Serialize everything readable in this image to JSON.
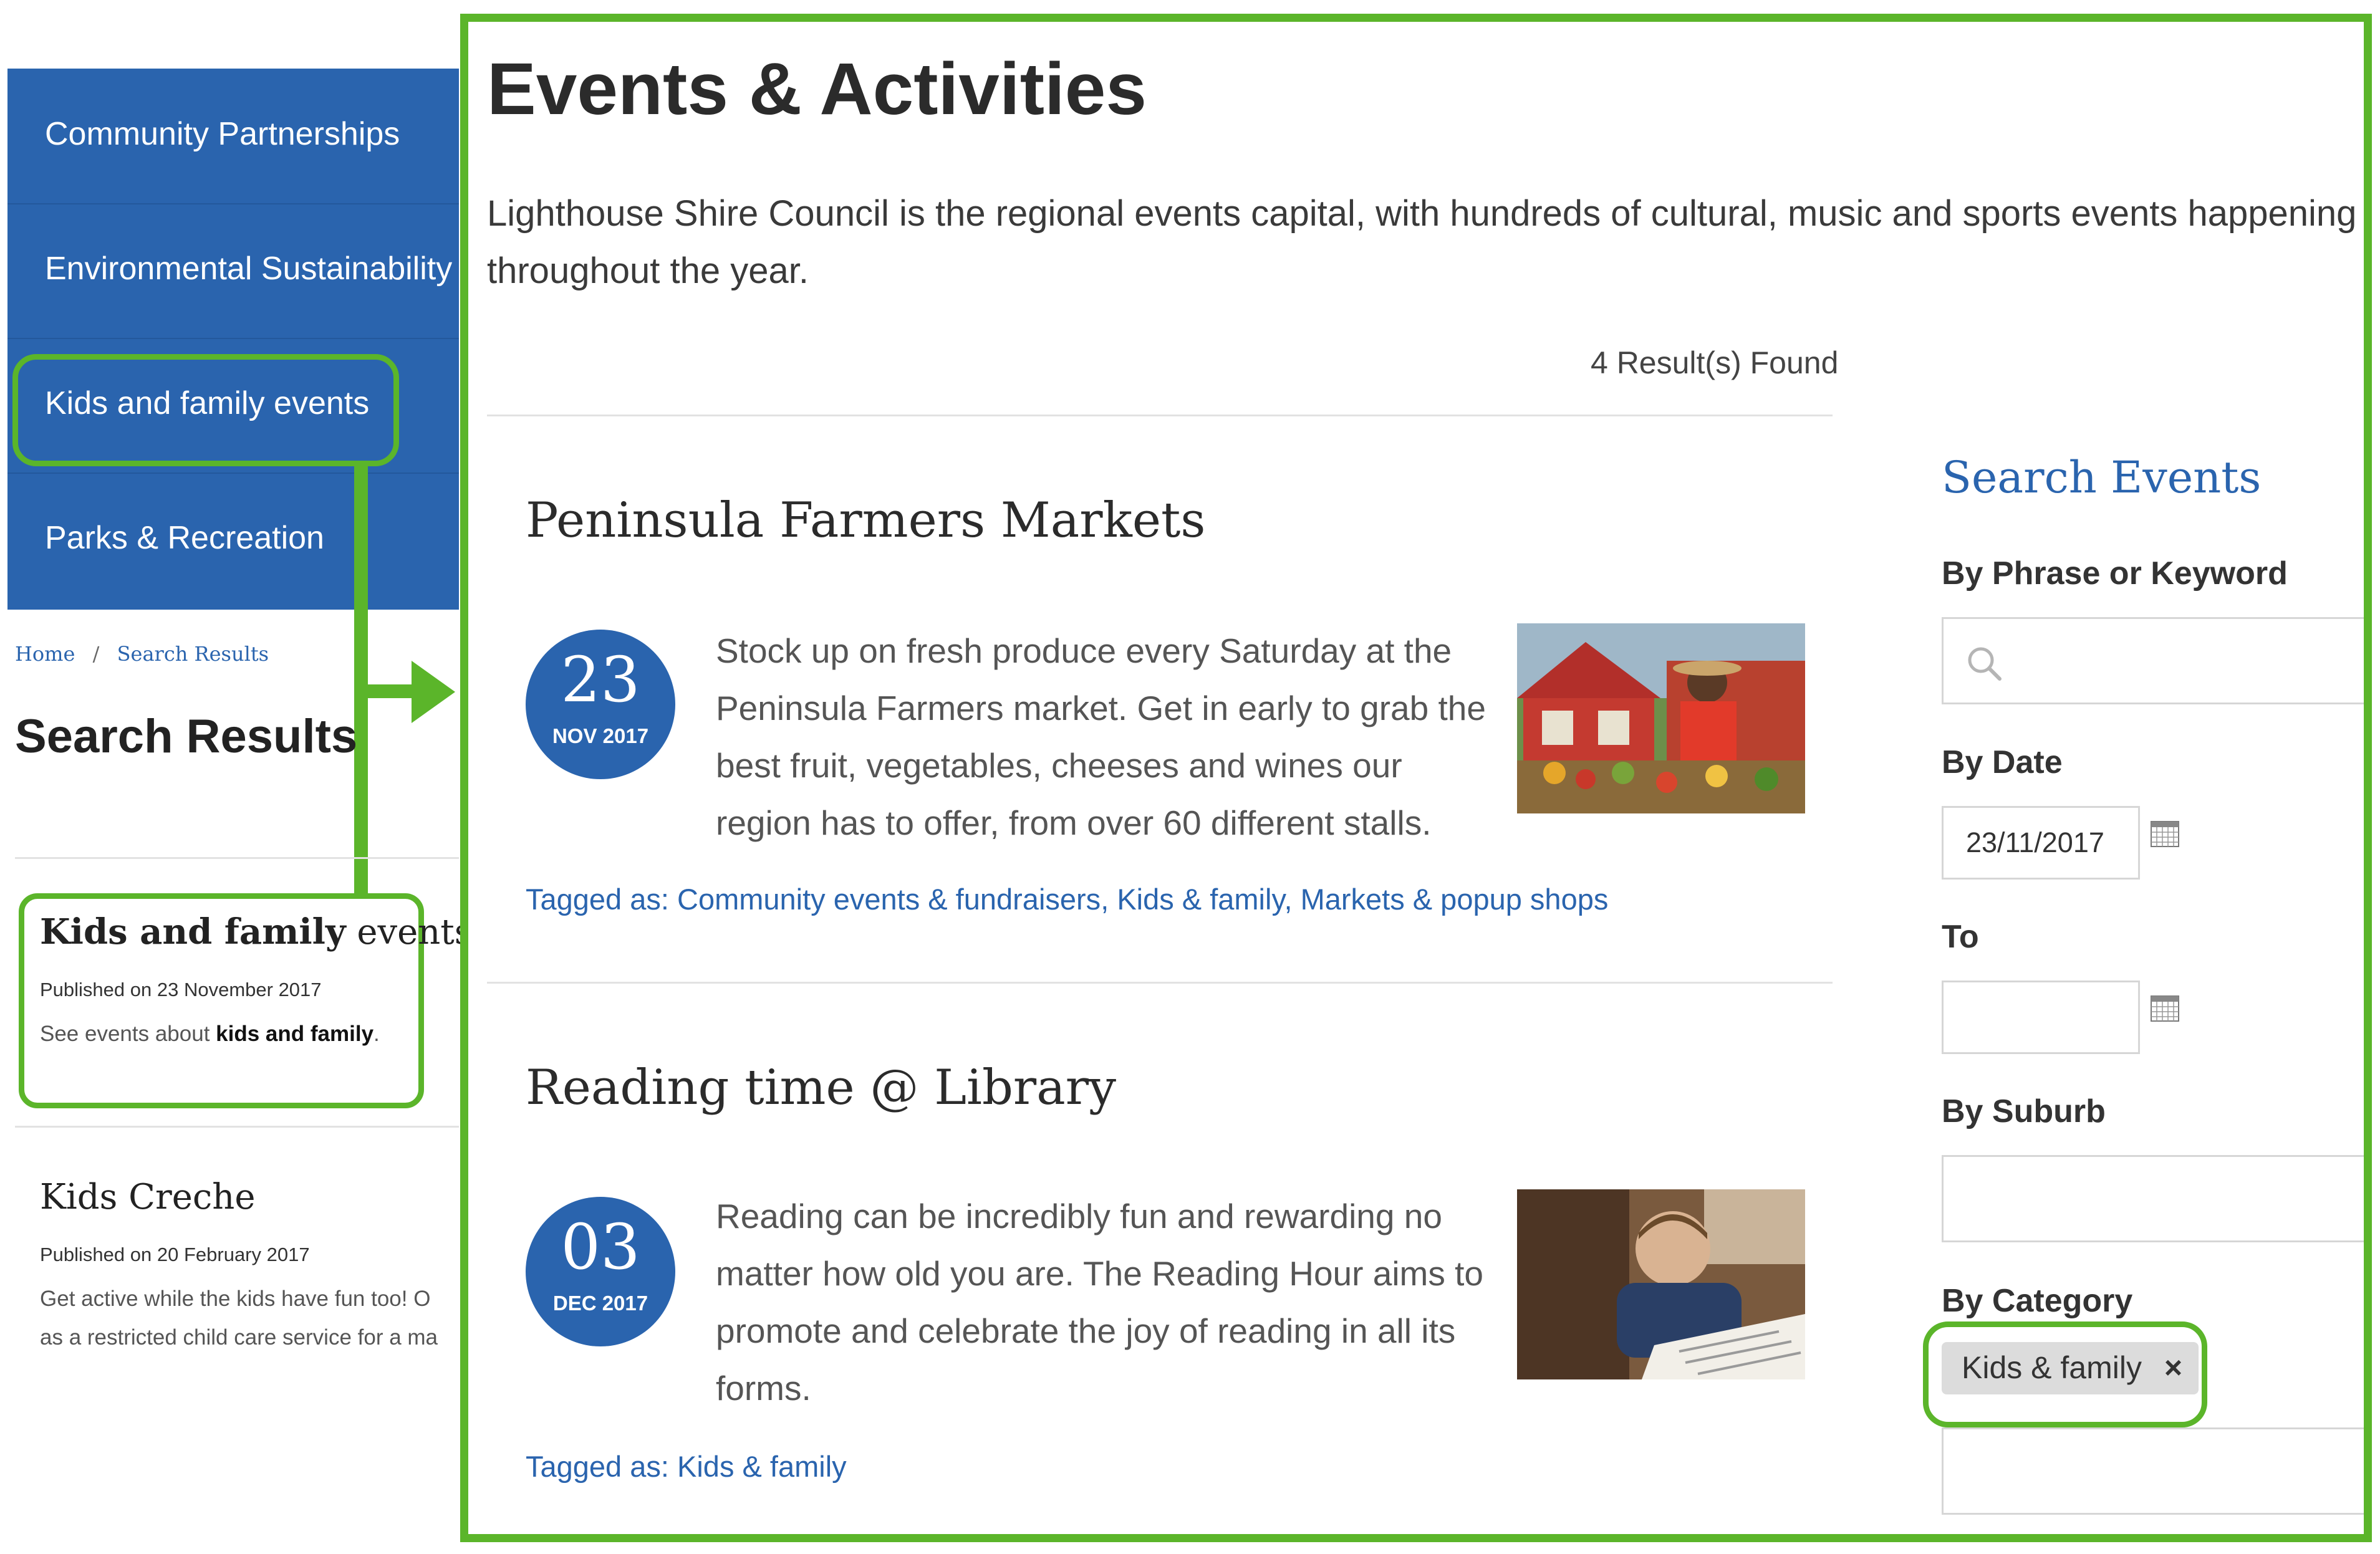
{
  "sidebar": {
    "items": [
      {
        "label": "Community Partnerships"
      },
      {
        "label": "Environmental Sustainability"
      },
      {
        "label": "Kids and family events"
      },
      {
        "label": "Parks & Recreation"
      }
    ]
  },
  "breadcrumb": {
    "home": "Home",
    "separator": "/",
    "current": "Search Results"
  },
  "search_results": {
    "title": "Search Results",
    "results": [
      {
        "title_part1": "Kids and family",
        "title_part2": "events",
        "published": "Published on 23 November 2017",
        "snippet_prefix": "See events about",
        "snippet_bold": "kids and family",
        "snippet_suffix": "."
      },
      {
        "title": "Kids Creche",
        "published": "Published on 20 February 2017",
        "snippet_line1": "Get active while the kids have fun too! O",
        "snippet_line2": "as a restricted child care service for a ma"
      }
    ]
  },
  "main": {
    "title": "Events & Activities",
    "intro": "Lighthouse Shire Council is the regional events capital, with hundreds of cultural, music and sports events happening throughout the year.",
    "results_count": "4 Result(s) Found",
    "events": [
      {
        "title": "Peninsula Farmers Markets",
        "day": "23",
        "month_year": "NOV 2017",
        "desc_lines": [
          "Stock up on fresh produce every Saturday at the",
          "Peninsula Farmers market. Get in early to grab the",
          "best fruit, vegetables, cheeses and wines our",
          "region has to offer, from over 60 different stalls."
        ],
        "tags_label": "Tagged as:",
        "tags": [
          "Community events & fundraisers",
          "Kids & family",
          "Markets & popup shops"
        ]
      },
      {
        "title": "Reading time @ Library",
        "day": "03",
        "month_year": "DEC 2017",
        "desc_lines": [
          "Reading can be incredibly fun and rewarding no",
          "matter how old you are. The Reading Hour aims to",
          "promote and celebrate the joy of reading in all its",
          "forms."
        ],
        "tags_label": "Tagged as:",
        "tags": [
          "Kids & family"
        ]
      }
    ]
  },
  "search_panel": {
    "title": "Search Events",
    "keyword_label": "By Phrase or Keyword",
    "keyword_icon": "search-icon",
    "date_label": "By Date",
    "date_value": "23/11/2017",
    "to_label": "To",
    "to_value": "",
    "suburb_label": "By Suburb",
    "category_label": "By Category",
    "category_chip": "Kids & family",
    "chip_remove": "×"
  },
  "colors": {
    "accent": "#2a64ae",
    "highlight": "#5bb52a"
  }
}
